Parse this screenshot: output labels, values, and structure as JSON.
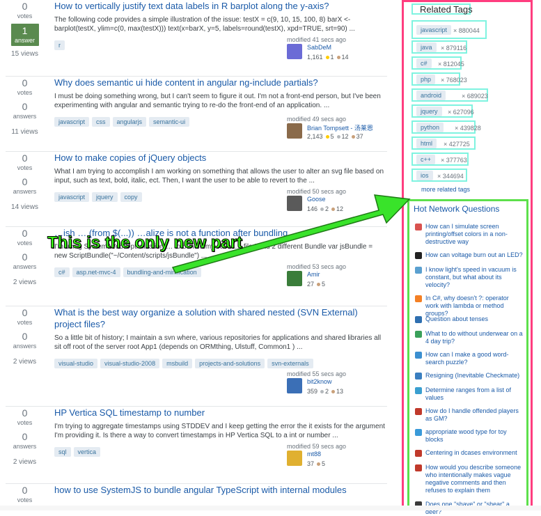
{
  "questions": [
    {
      "votes": "0",
      "votes_label": "votes",
      "answers": "1",
      "answers_label": "answer",
      "answered": true,
      "views": "15 views",
      "title": "How to vertically justify text data labels in R barplot along the y-axis?",
      "excerpt": "The following code provides a simple illustration of the issue: testX = c(9, 10, 15, 100, 8) barX <- barplot(testX, ylim=c(0, max(testX))) text(x=barX, y=5, labels=round(testX), xpd=TRUE, srt=90) ...",
      "tags": [
        "r"
      ],
      "modified": "modified 41 secs ago",
      "user": "SabDeM",
      "rep": "1,161",
      "gold": "1",
      "bronze": "14",
      "avatar_color": "#6b6bd6"
    },
    {
      "votes": "0",
      "votes_label": "votes",
      "answers": "0",
      "answers_label": "answers",
      "answered": false,
      "views": "11 views",
      "title": "Why does semantic ui hide content in angular ng-include partials?",
      "excerpt": "I must be doing something wrong, but I can't seem to figure it out. I'm not a front-end person, but I've been experimenting with angular and semantic trying to re-do the front-end of an application. ...",
      "tags": [
        "javascript",
        "css",
        "angularjs",
        "semantic-ui"
      ],
      "modified": "modified 49 secs ago",
      "user": "Brian Tompsett - 汤莱恩",
      "rep": "2,143",
      "gold": "5",
      "silver": "12",
      "bronze": "37",
      "avatar_color": "#8a6a4a"
    },
    {
      "votes": "0",
      "votes_label": "votes",
      "answers": "0",
      "answers_label": "answers",
      "answered": false,
      "views": "14 views",
      "title": "How to make copies of jQuery objects",
      "excerpt": "What I am trying to accomplish I am working on something that allows the user to alter an svg file based on input, such as text, bold, italic, ect. Then, I want the user to be able to revert to the ...",
      "tags": [
        "javascript",
        "jquery",
        "copy"
      ],
      "modified": "modified 50 secs ago",
      "user": "Goose",
      "rep": "146",
      "silver": "2",
      "bronze": "12",
      "avatar_color": "#5a5a5a"
    },
    {
      "votes": "0",
      "votes_label": "votes",
      "answers": "0",
      "answers_label": "answers",
      "answered": false,
      "views": "2 views",
      "title": "…ish … (from $(...)) …alize is not a function after bundling",
      "excerpt": "I'm using System.Web.Optimization … to bundle my Javas… file I had 2 different Bundle var jsBundle = new ScriptBundle(\"~/Content/scripts/jsBundle\") ...",
      "tags": [
        "c#",
        "asp.net-mvc-4",
        "bundling-and-minification"
      ],
      "modified": "modified 53 secs ago",
      "user": "Amir",
      "rep": "27",
      "bronze": "5",
      "avatar_color": "#3a7d3a"
    },
    {
      "votes": "0",
      "votes_label": "votes",
      "answers": "0",
      "answers_label": "answers",
      "answered": false,
      "views": "2 views",
      "title": "What is the best way organize a solution with shared nested (SVN External) project files?",
      "excerpt": "So a little bit of history; I maintain a svn where, various repositories for applications and shared libraries all sit off root of the server root App1 (depends on ORMthing, Ulstuff, Common1 ) ...",
      "tags": [
        "visual-studio",
        "visual-studio-2008",
        "msbuild",
        "projects-and-solutions",
        "svn-externals"
      ],
      "modified": "modified 55 secs ago",
      "user": "bit2know",
      "rep": "359",
      "silver": "2",
      "bronze": "13",
      "avatar_color": "#3b6fb6"
    },
    {
      "votes": "0",
      "votes_label": "votes",
      "answers": "0",
      "answers_label": "answers",
      "answered": false,
      "views": "2 views",
      "title": "HP Vertica SQL timestamp to number",
      "excerpt": "I'm trying to aggregate timestamps using STDDEV and I keep getting the error the it exists for the argument I'm providing it. Is there a way to convert timestamps in HP Vertica SQL to a int or number ...",
      "tags": [
        "sql",
        "vertica"
      ],
      "modified": "modified 59 secs ago",
      "user": "mt88",
      "rep": "37",
      "bronze": "5",
      "avatar_color": "#e0b030"
    },
    {
      "votes": "0",
      "votes_label": "votes",
      "title": "how to use SystemJS to bundle angular TypeScript with internal modules"
    }
  ],
  "related_tags": {
    "title": "Related Tags",
    "items": [
      {
        "tag": "javascript",
        "count": "× 880044"
      },
      {
        "tag": "java",
        "count": "× 879116"
      },
      {
        "tag": "c#",
        "count": "× 812045"
      },
      {
        "tag": "php",
        "count": "× 768023"
      },
      {
        "tag": "android",
        "count": "× 689023"
      },
      {
        "tag": "jquery",
        "count": "× 627096"
      },
      {
        "tag": "python",
        "count": "× 439828"
      },
      {
        "tag": "html",
        "count": "× 427725"
      },
      {
        "tag": "c++",
        "count": "× 377763"
      },
      {
        "tag": "ios",
        "count": "× 344694"
      }
    ],
    "more": "more related tags"
  },
  "hot_network": {
    "title": "Hot Network Questions",
    "items": [
      {
        "text": "How can I simulate screen printing/offset colors in a non-destructive way",
        "color": "#d9534f"
      },
      {
        "text": "How can voltage burn out an LED?",
        "color": "#222222"
      },
      {
        "text": "I know light's speed in vacuum is constant, but what about its velocity?",
        "color": "#5aa0d0"
      },
      {
        "text": "In C#, why doesn't ?: operator work with lambda or method groups?",
        "color": "#f48024"
      },
      {
        "text": "Question about tenses",
        "color": "#2f6fb0"
      },
      {
        "text": "What to do without underwear on a 4 day trip?",
        "color": "#3aa05a"
      },
      {
        "text": "How can I make a good word-search puzzle?",
        "color": "#3b8fd0"
      },
      {
        "text": "Resigning (Inevitable Checkmate)",
        "color": "#3a7fc0"
      },
      {
        "text": "Determine ranges from a list of values",
        "color": "#3a9fd0"
      },
      {
        "text": "How do I handle offended players as GM?",
        "color": "#c0392b"
      },
      {
        "text": "appropriate wood type for toy blocks",
        "color": "#3a9ad9"
      },
      {
        "text": "Centering in dcases environment",
        "color": "#c0392b"
      },
      {
        "text": "How would you describe someone who intentionally makes vague negative comments and then refuses to explain them",
        "color": "#c0392b"
      },
      {
        "text": "Does one \"shave\" or \"shear\" a deer?",
        "color": "#3a3a3a"
      }
    ]
  },
  "annotation": {
    "callout": "This is the only new part"
  },
  "colors": {
    "highlight_pink": "#ff3d7f",
    "highlight_green": "#5de04b",
    "highlight_cyan": "#7ff3e0",
    "callout_text": "#39ff14"
  }
}
